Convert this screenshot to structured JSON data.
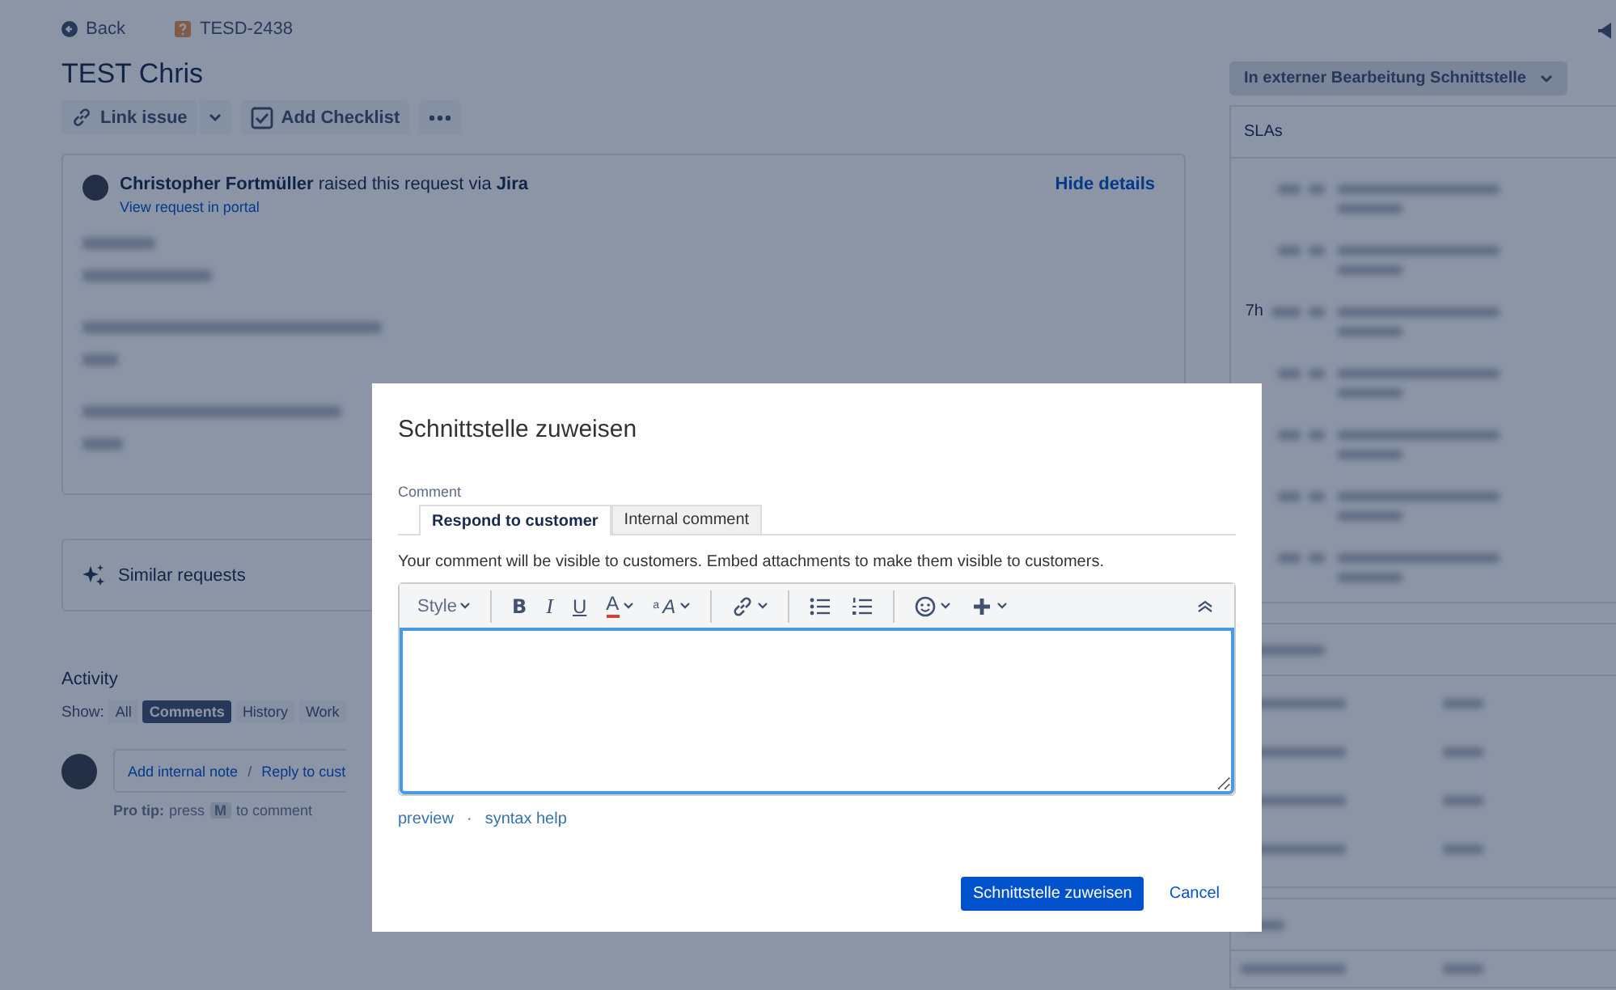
{
  "header": {
    "back": "Back",
    "issue_key": "TESD-2438"
  },
  "title": "TEST Chris",
  "actions": {
    "link_issue": "Link issue",
    "add_checklist": "Add Checklist"
  },
  "request": {
    "author": "Christopher Fortmüller",
    "raised_text": "raised this request via",
    "channel": "Jira",
    "portal_link": "View request in portal",
    "hide_details": "Hide details"
  },
  "similar": "Similar requests",
  "activity": {
    "heading": "Activity",
    "show_label": "Show:",
    "filters": [
      {
        "label": "All",
        "selected": false
      },
      {
        "label": "Comments",
        "selected": true
      },
      {
        "label": "History",
        "selected": false
      },
      {
        "label": "Work",
        "selected": false
      }
    ],
    "add_internal_note": "Add internal note",
    "separator": "/",
    "reply": "Reply to cust",
    "pro_tip_label": "Pro tip:",
    "pro_tip_press": "press",
    "pro_tip_key": "M",
    "pro_tip_end": "to comment"
  },
  "sidebar": {
    "status": "In externer Bearbeitung Schnittstelle",
    "slas_title": "SLAs",
    "sla_time": "7h"
  },
  "dialog": {
    "title": "Schnittstelle zuweisen",
    "comment_label": "Comment",
    "tabs": [
      {
        "label": "Respond to customer",
        "selected": true
      },
      {
        "label": "Internal comment",
        "selected": false
      }
    ],
    "note": "Your comment will be visible to customers. Embed attachments to make them visible to customers.",
    "toolbar": {
      "style": "Style",
      "bold": "B",
      "italic": "I",
      "underline": "U",
      "text_color": "A",
      "text_size_small": "a",
      "text_size_large": "A"
    },
    "preview": "preview",
    "dot": "·",
    "syntax_help": "syntax help",
    "submit": "Schnittstelle zuweisen",
    "cancel": "Cancel"
  }
}
